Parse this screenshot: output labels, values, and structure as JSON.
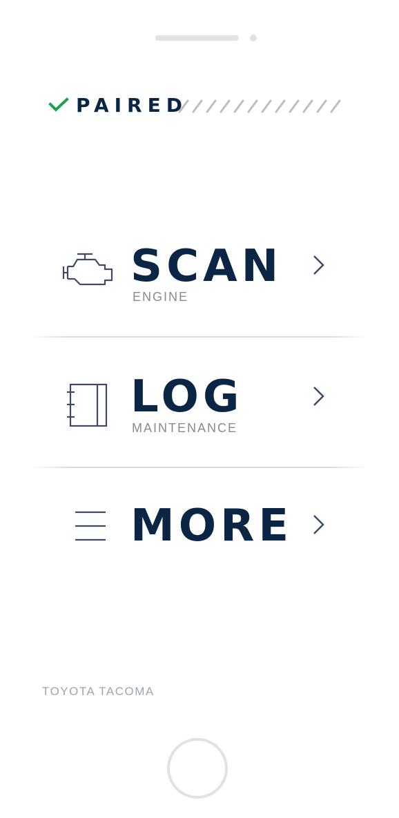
{
  "status": {
    "label": "PAIRED",
    "icon": "check-icon",
    "check_color": "#1aa34a"
  },
  "menu": {
    "items": [
      {
        "title": "SCAN",
        "subtitle": "ENGINE",
        "icon": "engine-icon"
      },
      {
        "title": "LOG",
        "subtitle": "MAINTENANCE",
        "icon": "logbook-icon"
      },
      {
        "title": "MORE",
        "subtitle": "",
        "icon": "menu-lines-icon"
      }
    ]
  },
  "vehicle": {
    "name": "TOYOTA TACOMA"
  },
  "colors": {
    "primary": "#0b2545",
    "icon_stroke": "#3d4a63",
    "muted": "#8a8a8a",
    "vehicle_text": "#9aa6b2"
  }
}
